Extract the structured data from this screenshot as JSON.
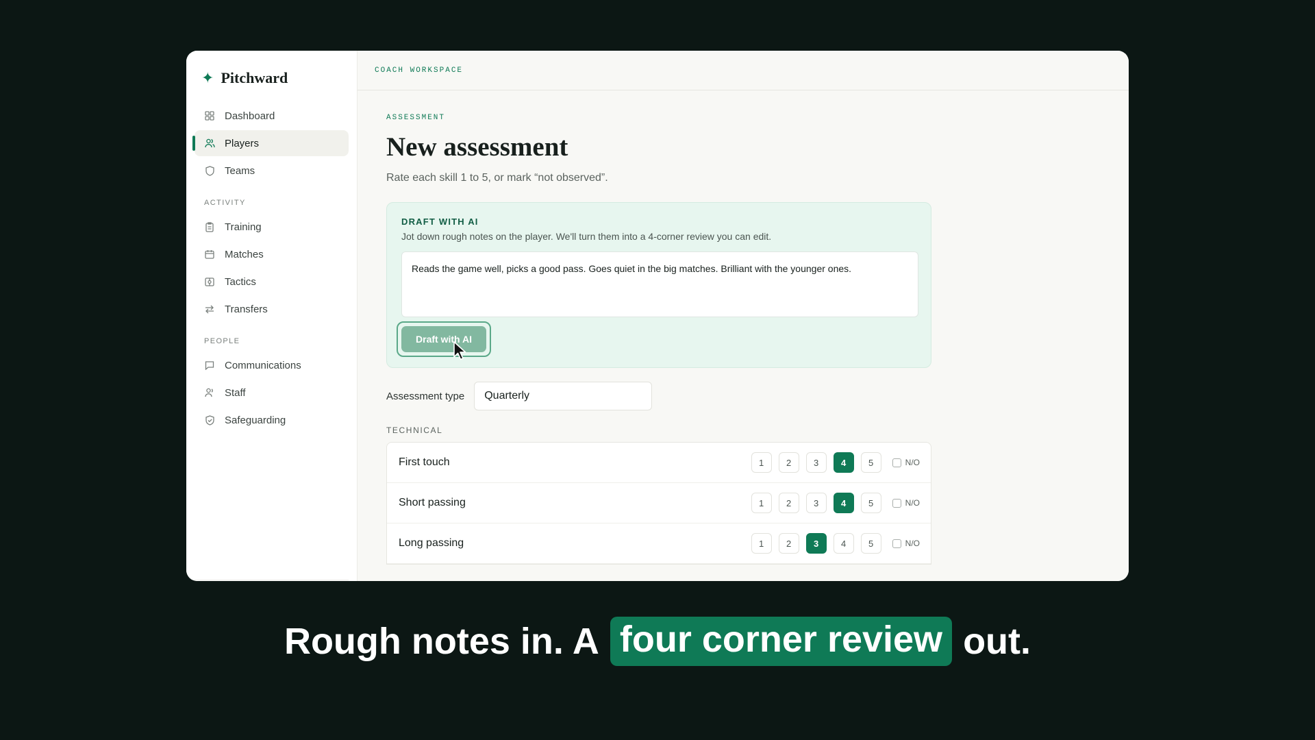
{
  "app": {
    "name": "Pitchward",
    "workspace_label": "COACH WORKSPACE"
  },
  "sidebar": {
    "items": [
      {
        "label": "Dashboard",
        "icon": "grid-icon"
      },
      {
        "label": "Players",
        "icon": "users-icon",
        "active": true
      },
      {
        "label": "Teams",
        "icon": "shield-icon"
      }
    ],
    "sections": [
      {
        "title": "ACTIVITY",
        "items": [
          {
            "label": "Training",
            "icon": "clipboard-icon"
          },
          {
            "label": "Matches",
            "icon": "calendar-icon"
          },
          {
            "label": "Tactics",
            "icon": "tactics-board-icon"
          },
          {
            "label": "Transfers",
            "icon": "swap-arrows-icon"
          }
        ]
      },
      {
        "title": "PEOPLE",
        "items": [
          {
            "label": "Communications",
            "icon": "message-icon"
          },
          {
            "label": "Staff",
            "icon": "user-icon"
          },
          {
            "label": "Safeguarding",
            "icon": "shield-check-icon"
          }
        ]
      }
    ]
  },
  "page": {
    "eyebrow": "ASSESSMENT",
    "title": "New assessment",
    "subtitle": "Rate each skill 1 to 5, or mark “not observed”."
  },
  "ai_draft": {
    "title": "DRAFT WITH AI",
    "description": "Jot down rough notes on the player. We'll turn them into a 4-corner review you can edit.",
    "notes_value": "Reads the game well, picks a good pass. Goes quiet in the big matches. Brilliant with the younger ones.",
    "button_label": "Draft with AI"
  },
  "assessment_type": {
    "label": "Assessment type",
    "value": "Quarterly"
  },
  "technical": {
    "section_label": "TECHNICAL",
    "rating_options": [
      "1",
      "2",
      "3",
      "4",
      "5"
    ],
    "not_observed_label": "N/O",
    "skills": [
      {
        "name": "First touch",
        "rating": 4
      },
      {
        "name": "Short passing",
        "rating": 4
      },
      {
        "name": "Long passing",
        "rating": 3
      }
    ]
  },
  "caption": {
    "before": "Rough notes in. A",
    "highlight": "four corner review",
    "after": "out."
  },
  "colors": {
    "accent": "#0f7a56",
    "background": "#0c1714",
    "ai_card": "#e7f6ef"
  }
}
